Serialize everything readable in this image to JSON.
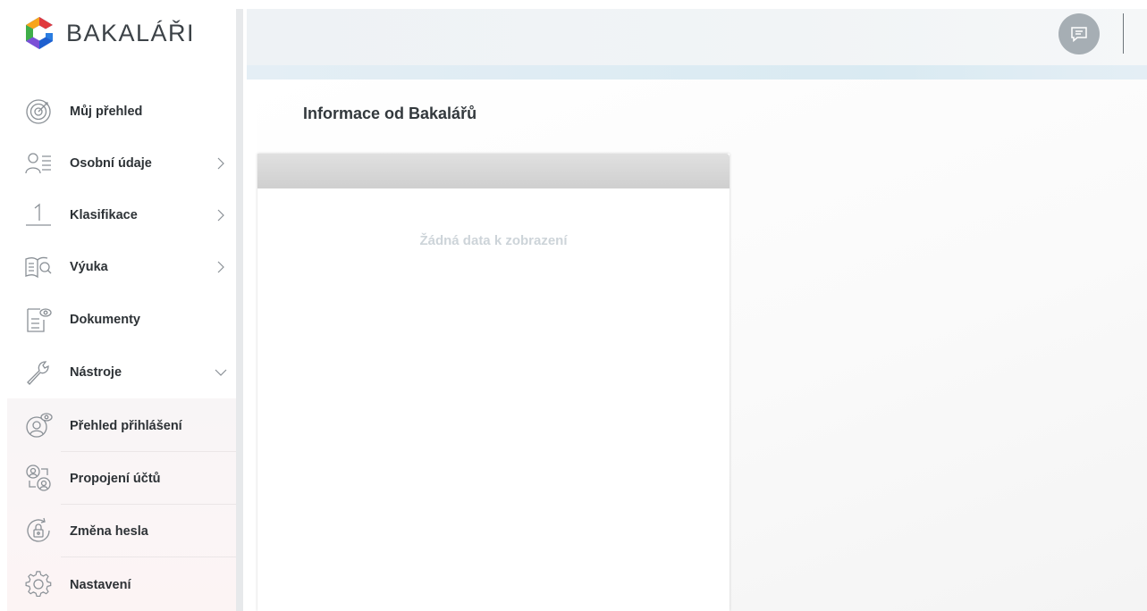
{
  "app": {
    "name": "BAKALÁŘI"
  },
  "sidebar": {
    "items": [
      {
        "label": "Můj přehled",
        "icon": "target-icon"
      },
      {
        "label": "Osobní údaje",
        "icon": "person-card-icon",
        "chevron": "chevron-right-icon"
      },
      {
        "label": "Klasifikace",
        "icon": "grade-one-icon",
        "chevron": "chevron-right-icon"
      },
      {
        "label": "Výuka",
        "icon": "book-search-icon",
        "chevron": "chevron-right-icon"
      },
      {
        "label": "Dokumenty",
        "icon": "document-icon"
      },
      {
        "label": "Nástroje",
        "icon": "wrench-icon",
        "chevron": "chevron-down-icon"
      }
    ],
    "tools_items": [
      {
        "label": "Přehled přihlášení",
        "icon": "login-overview-icon"
      },
      {
        "label": "Propojení účtů",
        "icon": "linked-accounts-icon"
      },
      {
        "label": "Změna hesla",
        "icon": "password-lock-icon"
      },
      {
        "label": "Nastavení",
        "icon": "settings-gear-icon"
      }
    ]
  },
  "header": {
    "chat_icon": "chat-icon"
  },
  "main": {
    "title": "Informace od Bakalářů",
    "card": {
      "empty_text": "Žádná data k zobrazení"
    }
  },
  "colors": {
    "logo_red": "#e03a3e",
    "logo_orange": "#f7a51c",
    "logo_green": "#3fae49",
    "logo_blue": "#2a7de1",
    "logo_purple": "#7b4fd6",
    "chat_button": "#a6aeb4"
  }
}
